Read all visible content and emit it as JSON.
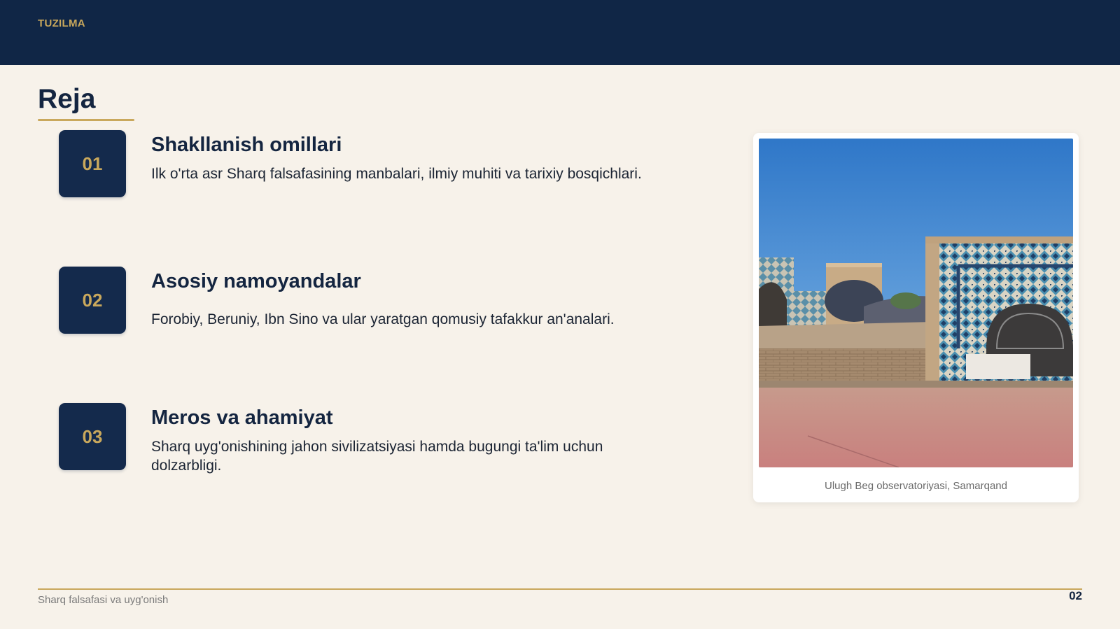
{
  "header": {
    "section_label": "TUZILMA"
  },
  "slide": {
    "title": "Reja"
  },
  "items": [
    {
      "number": "01",
      "title": "Shakllanish omillari",
      "description": "Ilk o'rta asr Sharq falsafasining manbalari, ilmiy muhiti va tarixiy bosqichlari."
    },
    {
      "number": "02",
      "title": "Asosiy namoyandalar",
      "description": "Forobiy, Beruniy, Ibn Sino va ular yaratgan qomusiy tafakkur an'analari."
    },
    {
      "number": "03",
      "title": "Meros va ahamiyat",
      "description": "Sharq uyg'onishining jahon sivilizatsiyasi hamda bugungi ta'lim uchun dolzarbligi."
    }
  ],
  "photo": {
    "caption": "Ulugh Beg observatoriyasi, Samarqand"
  },
  "footer": {
    "text": "Sharq falsafasi va uyg'onish",
    "page_number": "02"
  },
  "colors": {
    "navy": "#102646",
    "gold": "#c9a85c",
    "background": "#f7f2ea"
  }
}
